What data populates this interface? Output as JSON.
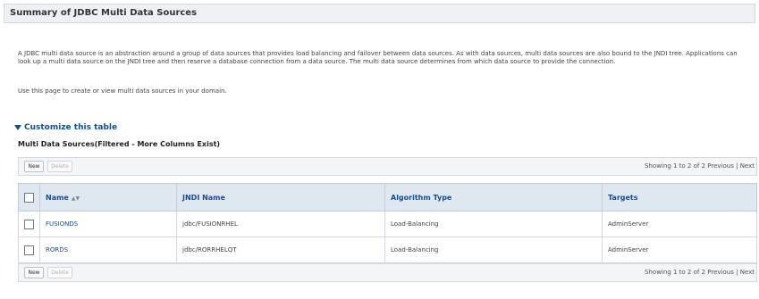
{
  "page": {
    "title": "Summary of JDBC Multi Data Sources",
    "description": "A JDBC multi data source is an abstraction around a group of data sources that provides load balancing and failover between data sources. As with data sources, multi data sources are also bound to the JNDI tree. Applications can look up a multi data source on the JNDI tree and then reserve a database connection from a data source. The multi data source determines from which data source to provide the connection.",
    "instruction": "Use this page to create or view multi data sources in your domain.",
    "customize_label": "Customize this table",
    "table_title": "Multi Data Sources(Filtered - More Columns Exist)"
  },
  "toolbar": {
    "new_label": "New",
    "delete_label": "Delete",
    "showing": "Showing 1 to 2 of 2",
    "previous": "Previous",
    "separator": "|",
    "next": "Next"
  },
  "table": {
    "columns": [
      "Name",
      "JNDI Name",
      "Algorithm Type",
      "Targets"
    ],
    "sort_icon": "sort-ascending-icon",
    "rows": [
      {
        "name": "FUSIONDS",
        "jndi": "jdbc/FUSIONRHEL",
        "algorithm": "Load-Balancing",
        "targets": "AdminServer"
      },
      {
        "name": "RORDS",
        "jndi": "jdbc/RORRHELQT",
        "algorithm": "Load-Balancing",
        "targets": "AdminServer"
      }
    ]
  },
  "colors": {
    "header_bg": "#dfe7f1",
    "link": "#1b4d8c",
    "title_bar_bg": "#eef1f4"
  }
}
